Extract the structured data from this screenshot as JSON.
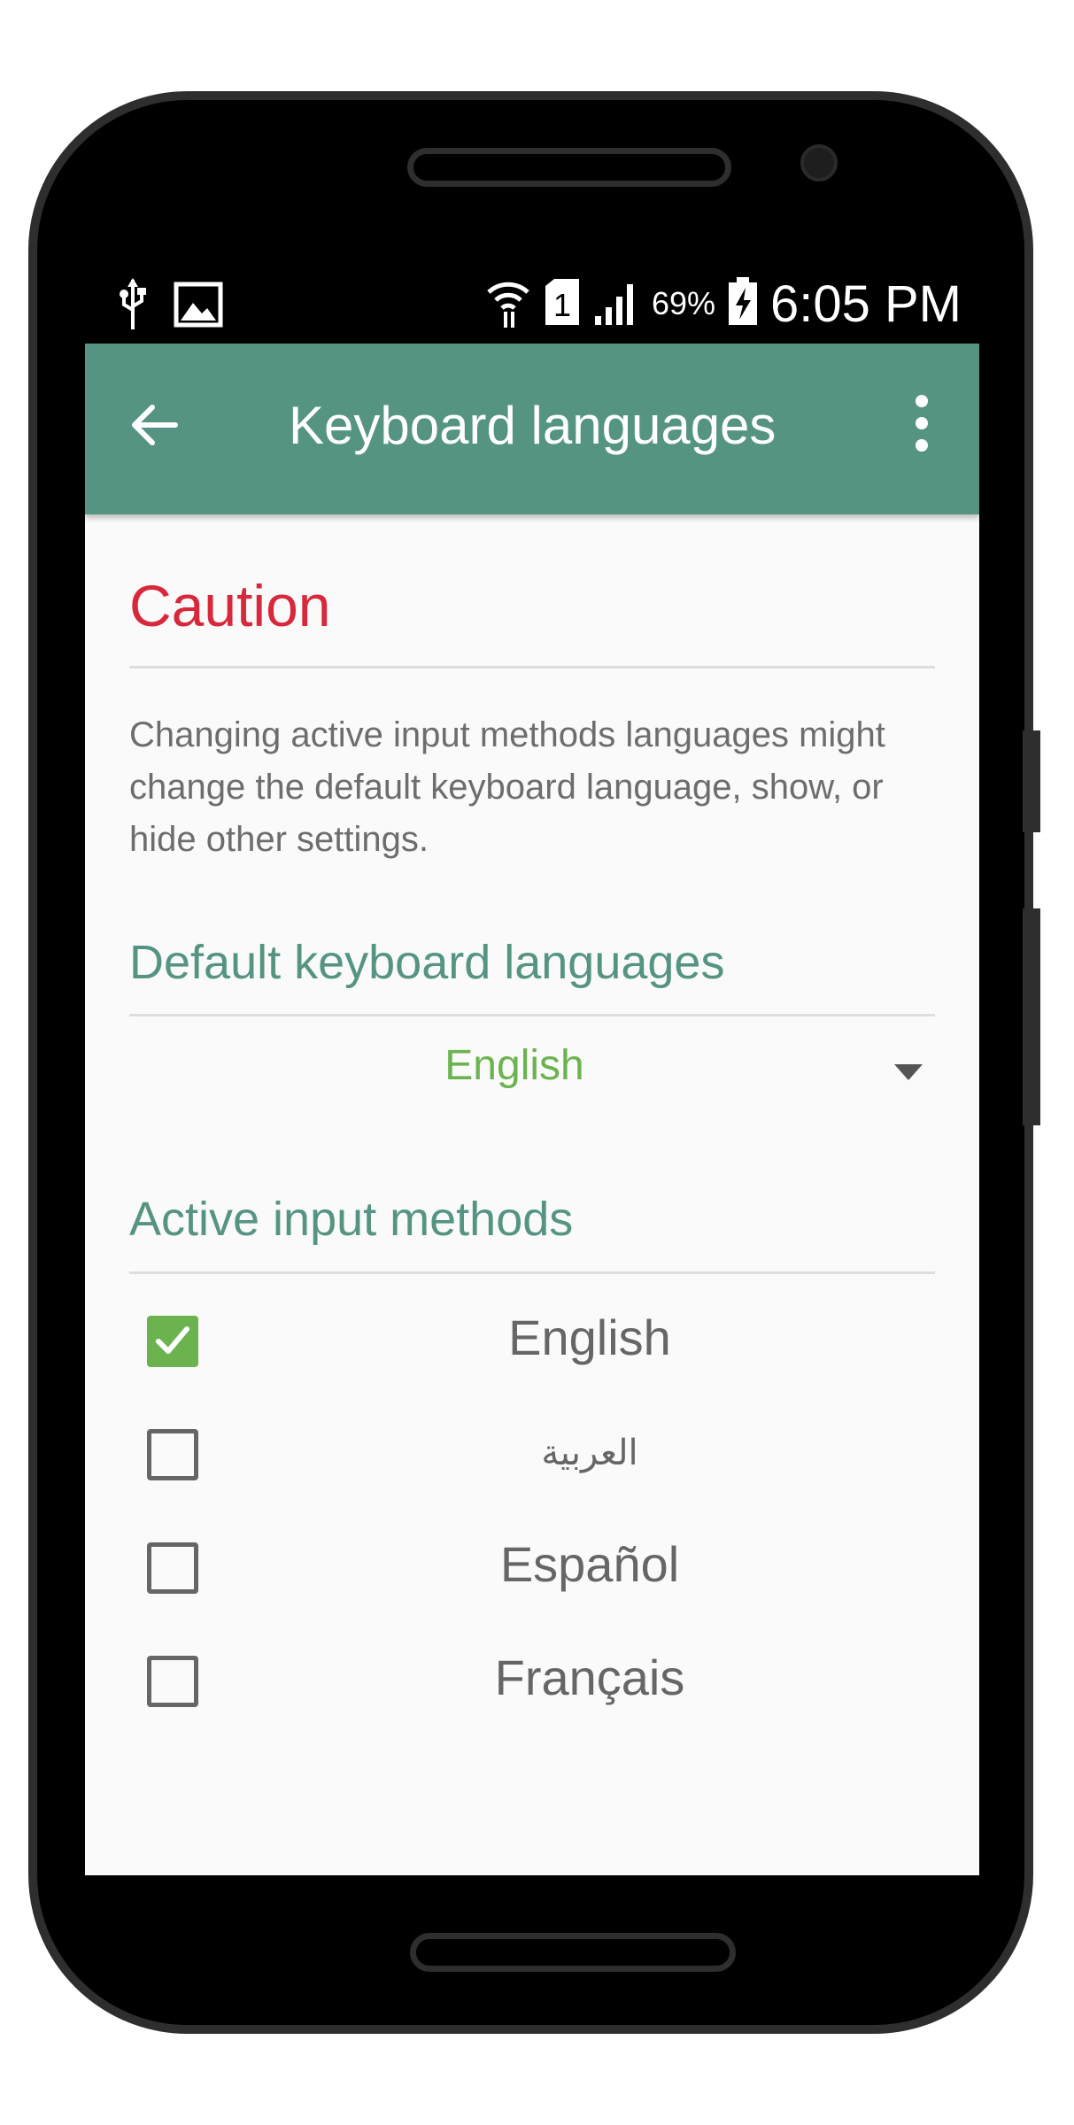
{
  "status_bar": {
    "battery_percent": "69%",
    "time": "6:05 PM",
    "sim_slot": "1",
    "left_icons": [
      "usb-icon",
      "image-icon"
    ],
    "right_icons": [
      "wifi-icon",
      "sim-icon",
      "signal-icon",
      "battery-icon"
    ]
  },
  "app_bar": {
    "title": "Keyboard languages",
    "back_icon": "arrow-left-icon",
    "menu_icon": "more-vert-icon",
    "color": "#559483"
  },
  "caution": {
    "heading": "Caution",
    "text": "Changing active input methods languages might change the default keyboard language, show, or hide other settings.",
    "color": "#d8283b"
  },
  "default_keyboard": {
    "heading": "Default keyboard languages",
    "selected": "English"
  },
  "active_methods": {
    "heading": "Active input methods",
    "items": [
      {
        "label": "English",
        "checked": true
      },
      {
        "label": "العربية",
        "checked": false
      },
      {
        "label": "Español",
        "checked": false
      },
      {
        "label": "Français",
        "checked": false
      }
    ]
  },
  "colors": {
    "accent_green": "#6bb34e",
    "section_teal": "#559483"
  }
}
